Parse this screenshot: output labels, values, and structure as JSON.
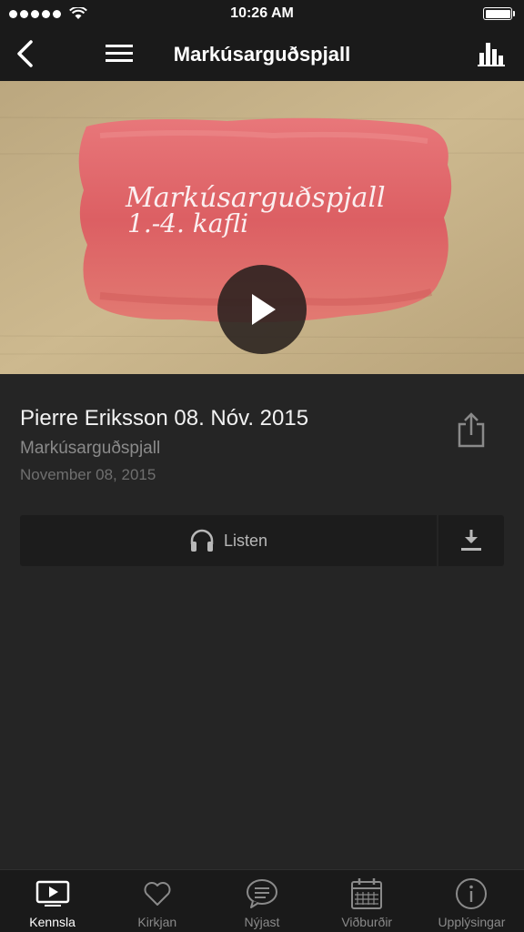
{
  "status_bar": {
    "time": "10:26 AM",
    "signal_icon": "signal-dots-icon",
    "wifi_icon": "wifi-icon",
    "battery_icon": "battery-icon"
  },
  "nav": {
    "title": "Markúsarguðspjall",
    "back_icon": "chevron-left-icon",
    "menu_icon": "hamburger-icon",
    "stats_icon": "bar-chart-icon"
  },
  "hero": {
    "artwork_line1": "Markúsarguðspjall",
    "artwork_line2": "1.-4. kafli",
    "play_icon": "play-icon"
  },
  "item": {
    "title": "Pierre Eriksson 08. Nóv. 2015",
    "series": "Markúsarguðspjall",
    "date": "November 08, 2015",
    "share_icon": "share-icon"
  },
  "actions": {
    "listen_label": "Listen",
    "listen_icon": "headphones-icon",
    "download_icon": "download-icon"
  },
  "tabs": [
    {
      "label": "Kennsla",
      "icon": "tv-play-icon",
      "active": true
    },
    {
      "label": "Kirkjan",
      "icon": "heart-icon",
      "active": false
    },
    {
      "label": "Nýjast",
      "icon": "chat-bubble-icon",
      "active": false
    },
    {
      "label": "Viðburðir",
      "icon": "calendar-icon",
      "active": false
    },
    {
      "label": "Upplýsingar",
      "icon": "info-icon",
      "active": false
    }
  ],
  "colors": {
    "background": "#252525",
    "bar": "#1a1a1a",
    "artwork_paper": "#c9b48c",
    "artwork_paint": "#e0676a",
    "text_secondary": "#8a8a8a"
  }
}
